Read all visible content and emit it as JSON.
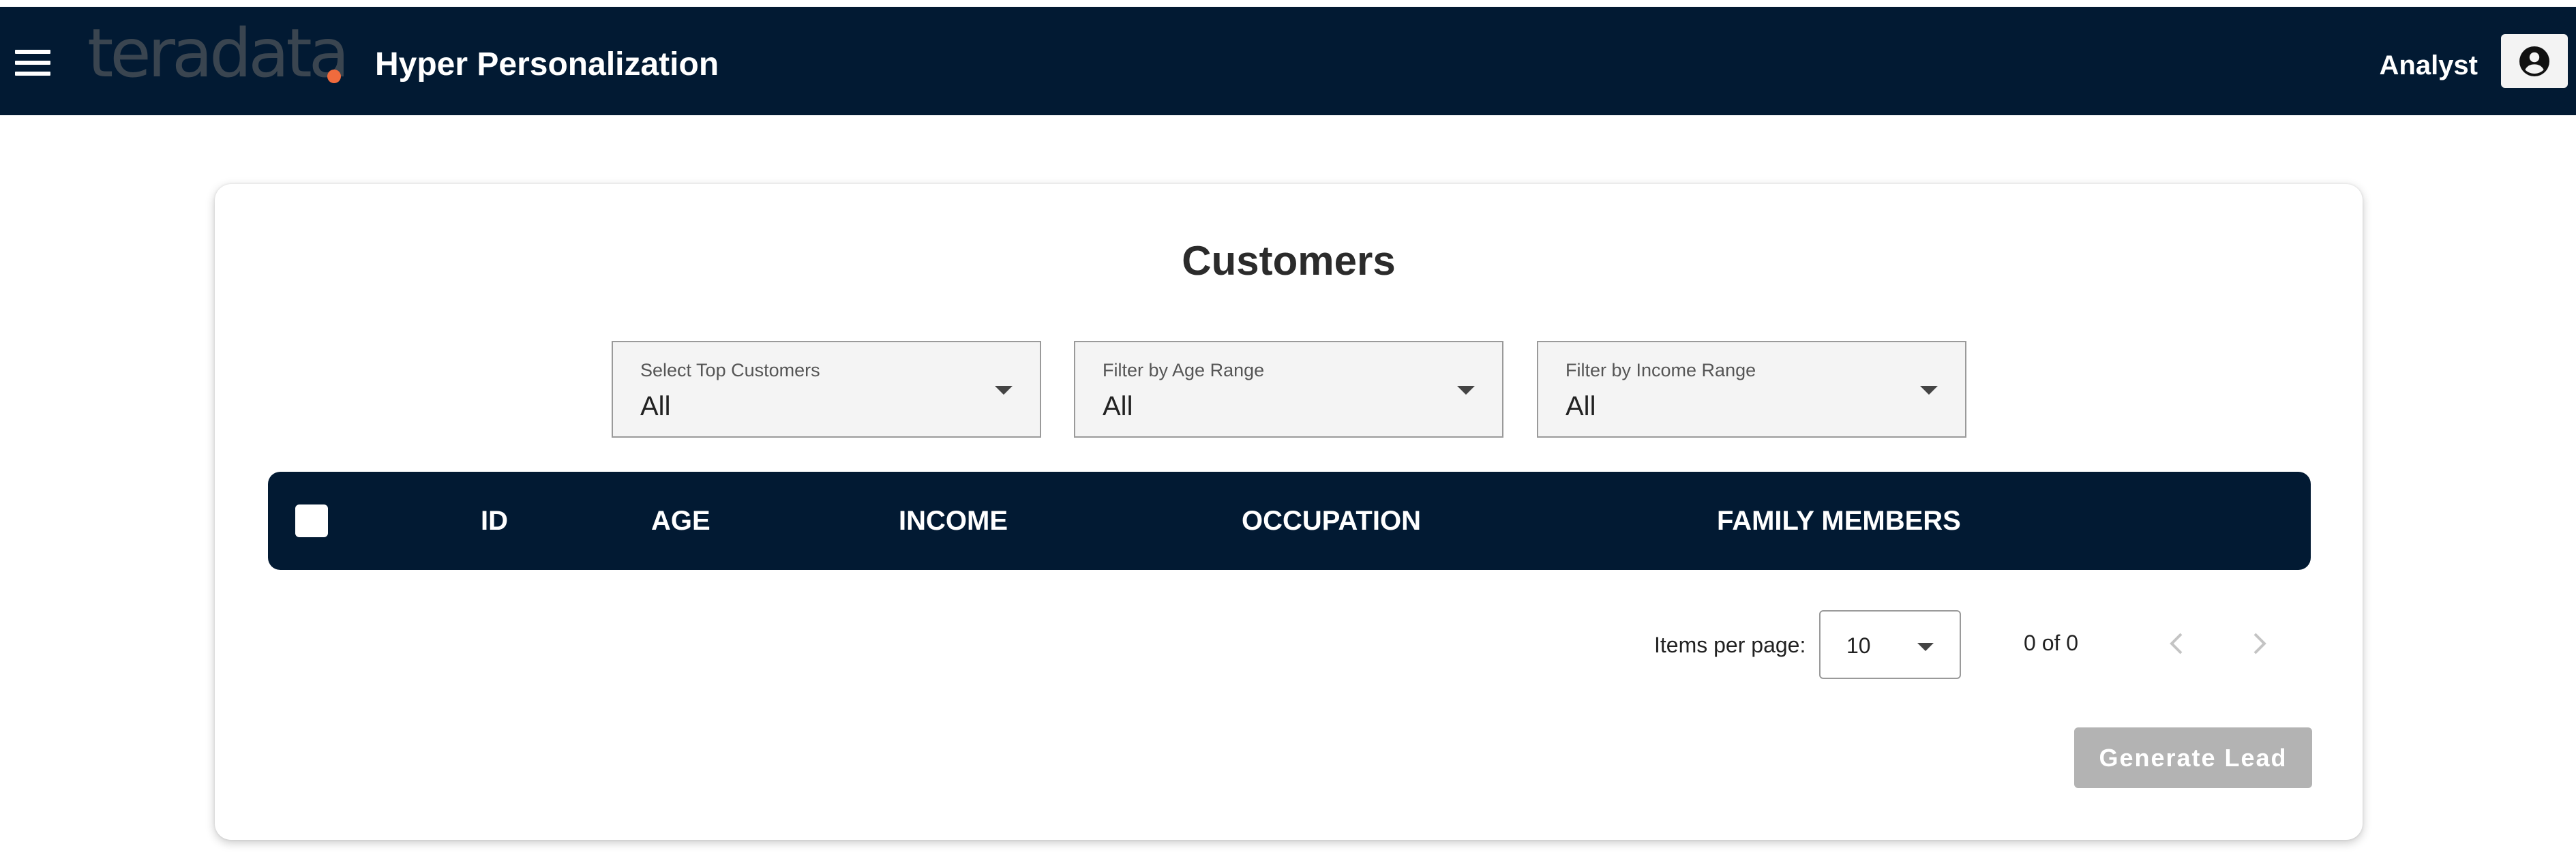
{
  "header": {
    "logo_text": "teradata",
    "app_title": "Hyper Personalization",
    "user_label": "Analyst",
    "menu_icon": "hamburger-menu-icon",
    "account_icon": "account-circle-icon",
    "background_color": "#021a33",
    "logo_accent_color": "#f06b3d"
  },
  "page": {
    "title": "Customers"
  },
  "filters": [
    {
      "label": "Select Top Customers",
      "value": "All"
    },
    {
      "label": "Filter by Age Range",
      "value": "All"
    },
    {
      "label": "Filter by Income Range",
      "value": "All"
    }
  ],
  "table": {
    "columns": [
      "ID",
      "AGE",
      "INCOME",
      "OCCUPATION",
      "FAMILY MEMBERS"
    ],
    "rows": [],
    "select_all_checked": false
  },
  "pagination": {
    "items_per_page_label": "Items per page:",
    "items_per_page_value": "10",
    "range_label": "0 of 0",
    "prev_icon": "chevron-left-icon",
    "next_icon": "chevron-right-icon"
  },
  "actions": {
    "generate_lead_label": "Generate Lead",
    "generate_lead_disabled": true
  }
}
